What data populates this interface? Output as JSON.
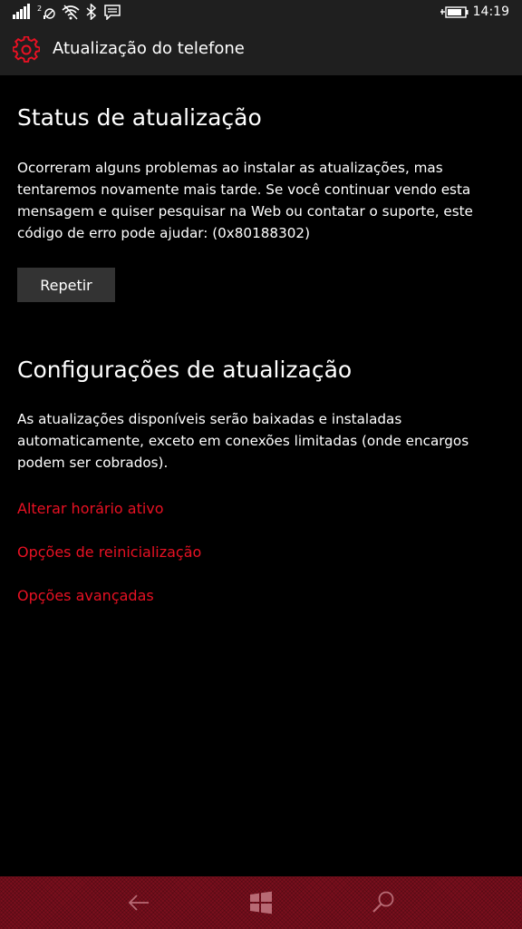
{
  "status_bar": {
    "time": "14:19",
    "icons": [
      "signal-icon",
      "sim2-no-signal-icon",
      "wifi-icon",
      "bluetooth-icon",
      "notification-icon",
      "battery-charging-icon"
    ]
  },
  "title_bar": {
    "icon": "gear-icon",
    "title": "Atualização do telefone"
  },
  "update_status": {
    "heading": "Status de atualização",
    "message": "Ocorreram alguns problemas ao instalar as atualizações, mas tentaremos novamente mais tarde. Se você continuar vendo esta mensagem e quiser pesquisar na Web ou contatar o suporte, este código de erro pode ajudar: (0x80188302)",
    "retry_label": "Repetir"
  },
  "update_settings": {
    "heading": "Configurações de atualização",
    "description": "As atualizações disponíveis serão baixadas e instaladas automaticamente, exceto em conexões limitadas (onde encargos podem ser cobrados).",
    "links": [
      "Alterar horário ativo",
      "Opções de reinicialização",
      "Opções avançadas"
    ]
  },
  "colors": {
    "accent": "#e81123",
    "background": "#000000",
    "bar_background": "#1f1f1f",
    "button_background": "#333333",
    "nav_bar": "#7a0f1d"
  },
  "nav_bar": {
    "icons": [
      "back-arrow-icon",
      "windows-start-icon",
      "search-icon"
    ]
  }
}
